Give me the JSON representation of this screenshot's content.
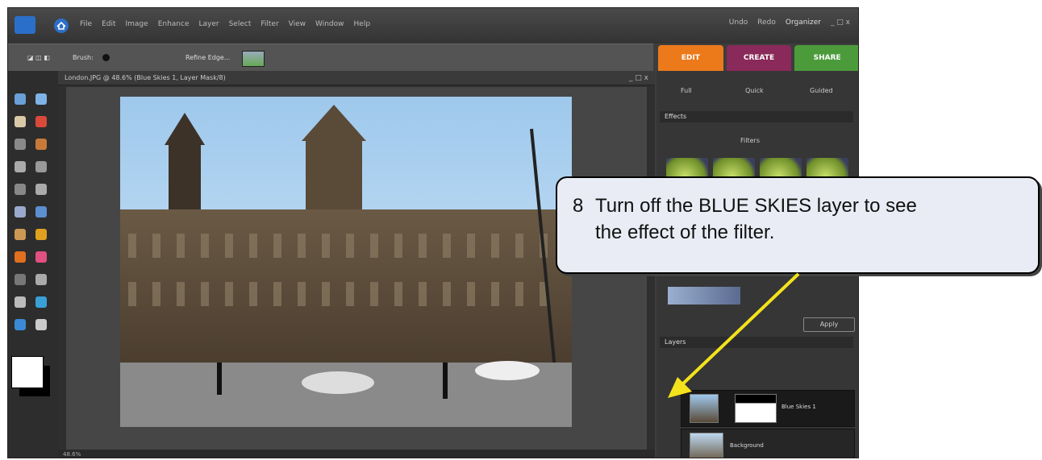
{
  "window": {
    "menu": [
      "File",
      "Edit",
      "Image",
      "Enhance",
      "Layer",
      "Select",
      "Filter",
      "View",
      "Window",
      "Help"
    ],
    "right_menu": [
      "Undo",
      "Redo",
      "Organizer",
      "_ □ x"
    ]
  },
  "options_bar": {
    "brush_label": "Brush:",
    "refine_label": "Refine Edge..."
  },
  "mode_tabs": [
    "EDIT",
    "CREATE",
    "SHARE"
  ],
  "edit_modes": [
    "Full",
    "Quick",
    "Guided"
  ],
  "document": {
    "title": "London.JPG @ 48.6% (Blue Skies 1, Layer Mask/8)",
    "zoom": "48.6%"
  },
  "panels": {
    "effects_header": "Effects",
    "filters_label": "Filters",
    "layers_header": "Layers",
    "apply_button": "Apply"
  },
  "layers": [
    {
      "name": "Blue Skies 1",
      "selected": true
    },
    {
      "name": "Background",
      "selected": false
    }
  ],
  "instruction": {
    "number": "8",
    "line1": "Turn off the BLUE SKIES layer to see",
    "line2": "the effect of the filter."
  },
  "colors": {
    "edit_tab": "#ec7a1b",
    "create_tab": "#8a2a5a",
    "share_tab": "#4c9b3b",
    "arrow": "#f4e21c"
  }
}
